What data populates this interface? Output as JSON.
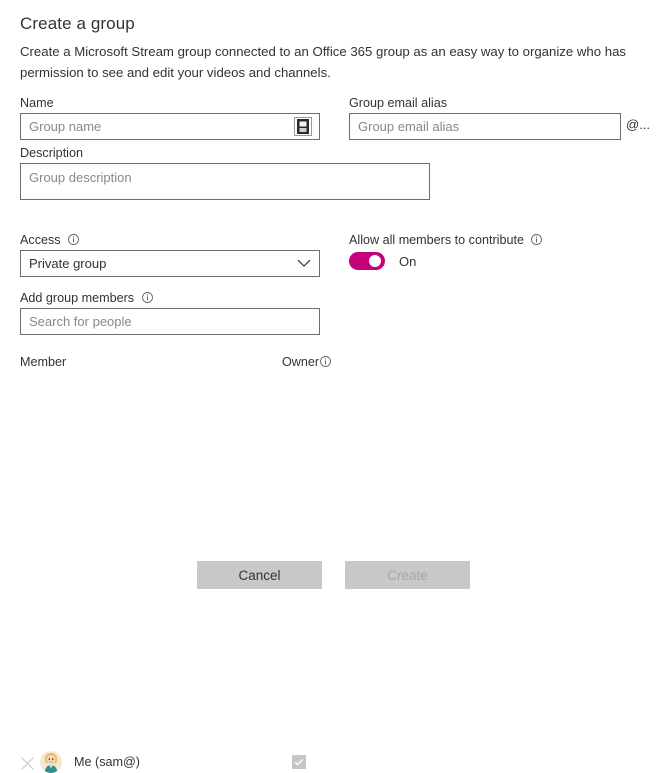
{
  "dialog": {
    "title": "Create a group",
    "description": "Create a Microsoft Stream group connected to an Office 365 group as an easy way to organize who has permission to see and edit your videos and channels."
  },
  "form": {
    "name": {
      "label": "Name",
      "value": "",
      "placeholder": "Group name",
      "icon": "ime-input-icon"
    },
    "email_alias": {
      "label": "Group email alias",
      "value": "",
      "placeholder": "Group email alias",
      "suffix": "@..."
    },
    "description": {
      "label": "Description",
      "value": "",
      "placeholder": "Group description"
    },
    "access": {
      "label": "Access",
      "has_info_icon": true,
      "selected": "Private group",
      "options": [
        "Private group"
      ],
      "chevron": "chevron-down-icon"
    },
    "contribute": {
      "label": "Allow all members to contribute",
      "has_info_icon": true,
      "state_label": "On",
      "enabled": true,
      "accent_color": "#c4007a"
    },
    "add_members": {
      "label": "Add group members",
      "has_info_icon": true,
      "value": "",
      "placeholder": "Search for people"
    }
  },
  "members_table": {
    "columns": {
      "member": "Member",
      "owner": "Owner"
    },
    "owner_has_info_icon": true,
    "rows": [
      {
        "name": "Me (sam@)",
        "is_owner": true,
        "owner_checkbox_disabled": true,
        "remove_icon": "close-icon",
        "avatar": "user-avatar"
      }
    ]
  },
  "footer": {
    "cancel_label": "Cancel",
    "create_label": "Create",
    "create_disabled": true
  },
  "colors": {
    "accent": "#c4007a",
    "text": "#333333",
    "placeholder": "#8a8886",
    "border": "#6e6e6e",
    "button_bg": "#c8c8c8",
    "button_disabled_text": "#a6a6a6"
  }
}
